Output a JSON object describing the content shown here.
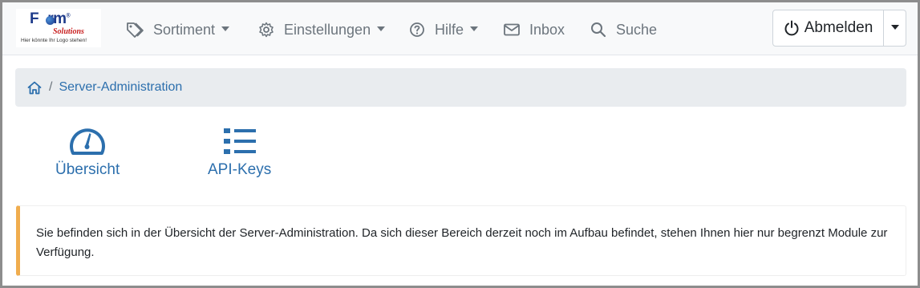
{
  "logo": {
    "brand_main_prefix": "F",
    "brand_main_o": "o",
    "brand_main_suffix": "rm",
    "brand_registered": "®",
    "brand_sub": "Solutions",
    "tagline": "Hier könnte Ihr Logo stehen!"
  },
  "nav": {
    "items": [
      {
        "label": "Sortiment",
        "icon": "tags-icon",
        "dropdown": true
      },
      {
        "label": "Einstellungen",
        "icon": "gear-icon",
        "dropdown": true
      },
      {
        "label": "Hilfe",
        "icon": "question-circle-icon",
        "dropdown": true
      },
      {
        "label": "Inbox",
        "icon": "envelope-icon",
        "dropdown": false
      },
      {
        "label": "Suche",
        "icon": "search-icon",
        "dropdown": false
      }
    ],
    "logout_label": "Abmelden"
  },
  "breadcrumb": {
    "home_icon": "home-icon",
    "separator": "/",
    "current": "Server-Administration"
  },
  "tiles": [
    {
      "label": "Übersicht",
      "icon": "speedometer-icon"
    },
    {
      "label": "API-Keys",
      "icon": "list-icon"
    }
  ],
  "alert": {
    "text": "Sie befinden sich in der Übersicht der Server-Administration. Da sich dieser Bereich derzeit noch im Aufbau befindet, stehen Ihnen hier nur begrenzt Module zur Verfügung."
  },
  "colors": {
    "link": "#2c6fad",
    "nav_text": "#6c757d",
    "alert_accent": "#f0ad4e",
    "breadcrumb_bg": "#e9ecef"
  }
}
